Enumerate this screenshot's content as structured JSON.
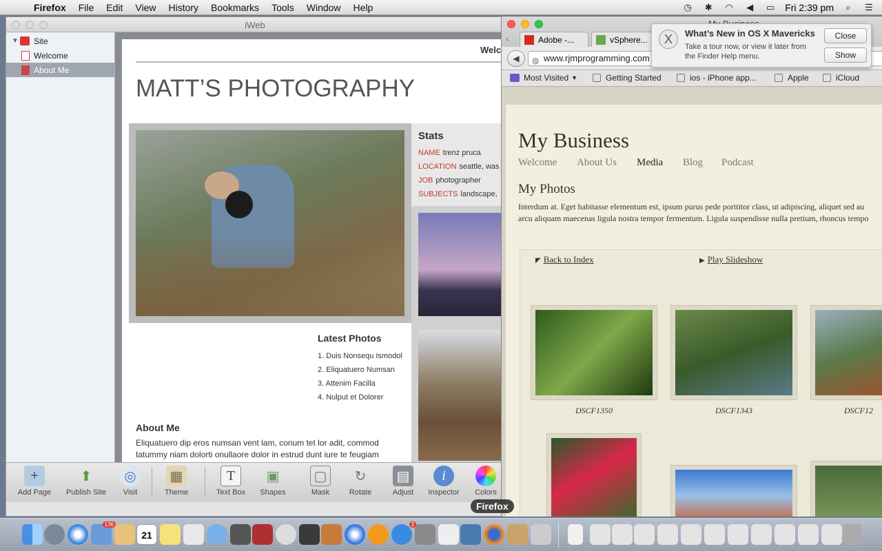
{
  "menubar": {
    "app": "Firefox",
    "items": [
      "File",
      "Edit",
      "View",
      "History",
      "Bookmarks",
      "Tools",
      "Window",
      "Help"
    ],
    "clock": "Fri 2:39 pm"
  },
  "iweb": {
    "title": "iWeb",
    "tree": {
      "site": "Site",
      "pages": [
        "Welcome",
        "About Me"
      ]
    },
    "page": {
      "welcome_fragment": "Welco",
      "title": "MATT’S PHOTOGRAPHY",
      "stats_heading": "Stats",
      "stats": [
        {
          "key": "NAME",
          "value": "trenz pruca"
        },
        {
          "key": "LOCATION",
          "value": "seattle, was"
        },
        {
          "key": "JOB",
          "value": "photographer"
        },
        {
          "key": "SUBJECTS",
          "value": "landscape,"
        }
      ],
      "latest_heading": "Latest Photos",
      "latest": [
        "1. Duis Nonsequ Ismodol",
        "2. Eliquatuero Numsan",
        "3. Attenim Facilla",
        "4. Nulput et Dolorer"
      ],
      "about_heading": "About Me",
      "about_text": "Eliquatuero dip eros numsan vent lam, conum tet lor adit, commod tatummy niam dolorti onullaore dolor in estrud dunt iure te feugiam"
    },
    "toolbar": {
      "buttons": [
        "Add Page",
        "Publish Site",
        "Visit",
        "Theme",
        "Text Box",
        "Shapes",
        "Mask",
        "Rotate",
        "Adjust",
        "Inspector",
        "Colors"
      ]
    }
  },
  "firefox": {
    "window_title": "My Business",
    "tabs": [
      "Adobe -...",
      "vSphere..."
    ],
    "url": "www.rjmprogramming.com",
    "bookmarks": [
      "Most Visited",
      "Getting Started",
      "ios - iPhone app...",
      "Apple",
      "iCloud"
    ],
    "site": {
      "title": "My Business",
      "nav": [
        "Welcome",
        "About Us",
        "Media",
        "Blog",
        "Podcast"
      ],
      "active_nav": "Media",
      "section": "My Photos",
      "lorem1": "Interdum at. Eget habitasse elementum est, ipsum purus pede porttitor class, ut adipiscing, aliquet sed au",
      "lorem2": "arcu aliquam maecenas ligula nostra tempor fermentum. Ligula suspendisse nulla pretium, rhoncus tempo",
      "back_link": "Back to Index",
      "slideshow_link": "Play Slideshow",
      "captions": [
        "DSCF1350",
        "DSCF1343",
        "DSCF12"
      ]
    }
  },
  "notification": {
    "title": "What’s New in OS X Mavericks",
    "body": "Take a tour now, or view it later from the Finder Help menu.",
    "close": "Close",
    "show": "Show"
  },
  "dock": {
    "tooltip": "Firefox",
    "mail_badge": "136",
    "calendar_day": "21",
    "appstore_badge": "3"
  }
}
